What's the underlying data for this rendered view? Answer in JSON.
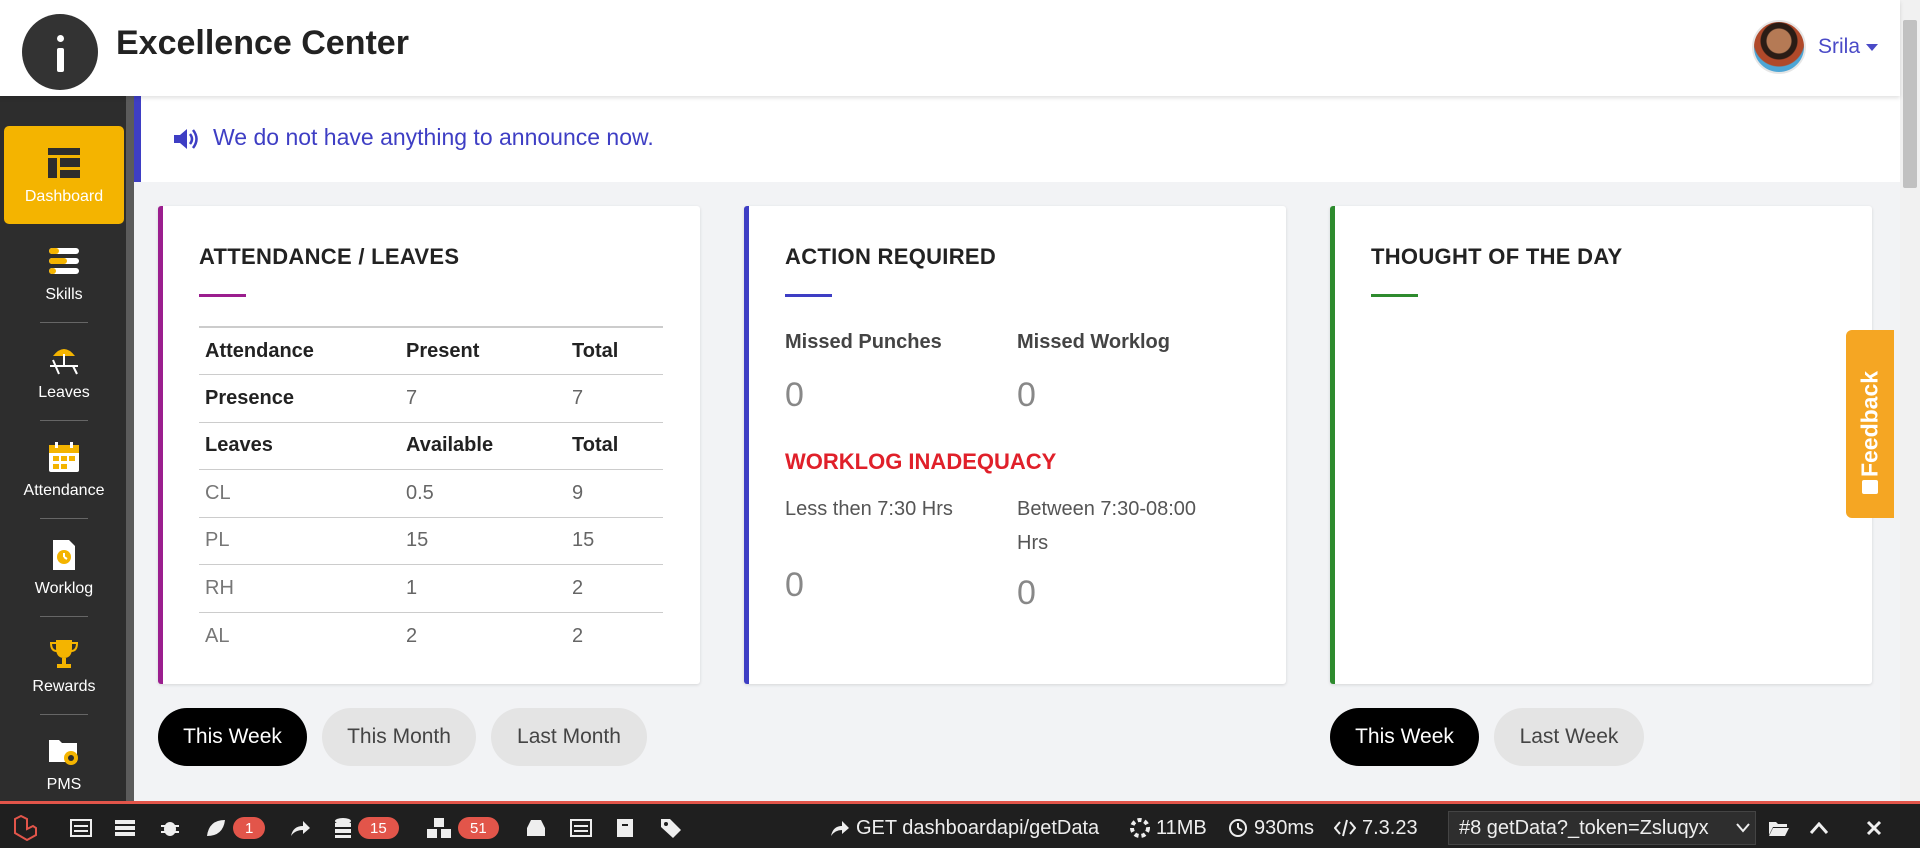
{
  "header": {
    "title": "Excellence Center",
    "user_name": "Srila"
  },
  "sidebar": {
    "items": [
      {
        "label": "Dashboard",
        "active": true
      },
      {
        "label": "Skills"
      },
      {
        "label": "Leaves"
      },
      {
        "label": "Attendance"
      },
      {
        "label": "Worklog"
      },
      {
        "label": "Rewards"
      },
      {
        "label": "PMS"
      }
    ]
  },
  "announcement": "We do not have anything to announce now.",
  "attendance_card": {
    "title": "ATTENDANCE / LEAVES",
    "attendance_headers": [
      "Attendance",
      "Present",
      "Total"
    ],
    "presence": {
      "label": "Presence",
      "present": "7",
      "total": "7"
    },
    "leave_headers": [
      "Leaves",
      "Available",
      "Total"
    ],
    "leaves": [
      {
        "type": "CL",
        "available": "0.5",
        "total": "9"
      },
      {
        "type": "PL",
        "available": "15",
        "total": "15"
      },
      {
        "type": "RH",
        "available": "1",
        "total": "2"
      },
      {
        "type": "AL",
        "available": "2",
        "total": "2"
      }
    ]
  },
  "action_card": {
    "title": "ACTION REQUIRED",
    "missed_punches_label": "Missed Punches",
    "missed_punches_value": "0",
    "missed_worklog_label": "Missed Worklog",
    "missed_worklog_value": "0",
    "inadequacy_title": "WORKLOG INADEQUACY",
    "less_label": "Less then 7:30 Hrs",
    "less_value": "0",
    "between_label_line1": "Between 7:30-08:00",
    "between_label_line2": "Hrs",
    "between_value": "0"
  },
  "thought_card": {
    "title": "THOUGHT OF THE DAY"
  },
  "filters_left": [
    "This Week",
    "This Month",
    "Last Month"
  ],
  "filters_right": [
    "This Week",
    "Last Week"
  ],
  "feedback_label": "Feedback",
  "debugbar": {
    "badges": {
      "messages": "1",
      "queries": "15",
      "models": "51"
    },
    "request": "GET dashboardapi/getData",
    "memory": "11MB",
    "time": "930ms",
    "version": "7.3.23",
    "request_select": "#8 getData?_token=Zsluqyx"
  },
  "colors": {
    "accent_blue": "#3e3ec4",
    "attendance_accent": "#9b1e8e",
    "thought_accent": "#2e8b2e",
    "sidebar_active": "#f4b400",
    "inadequacy_red": "#e0202a",
    "feedback": "#f5a623",
    "debug_accent": "#e2554a"
  }
}
